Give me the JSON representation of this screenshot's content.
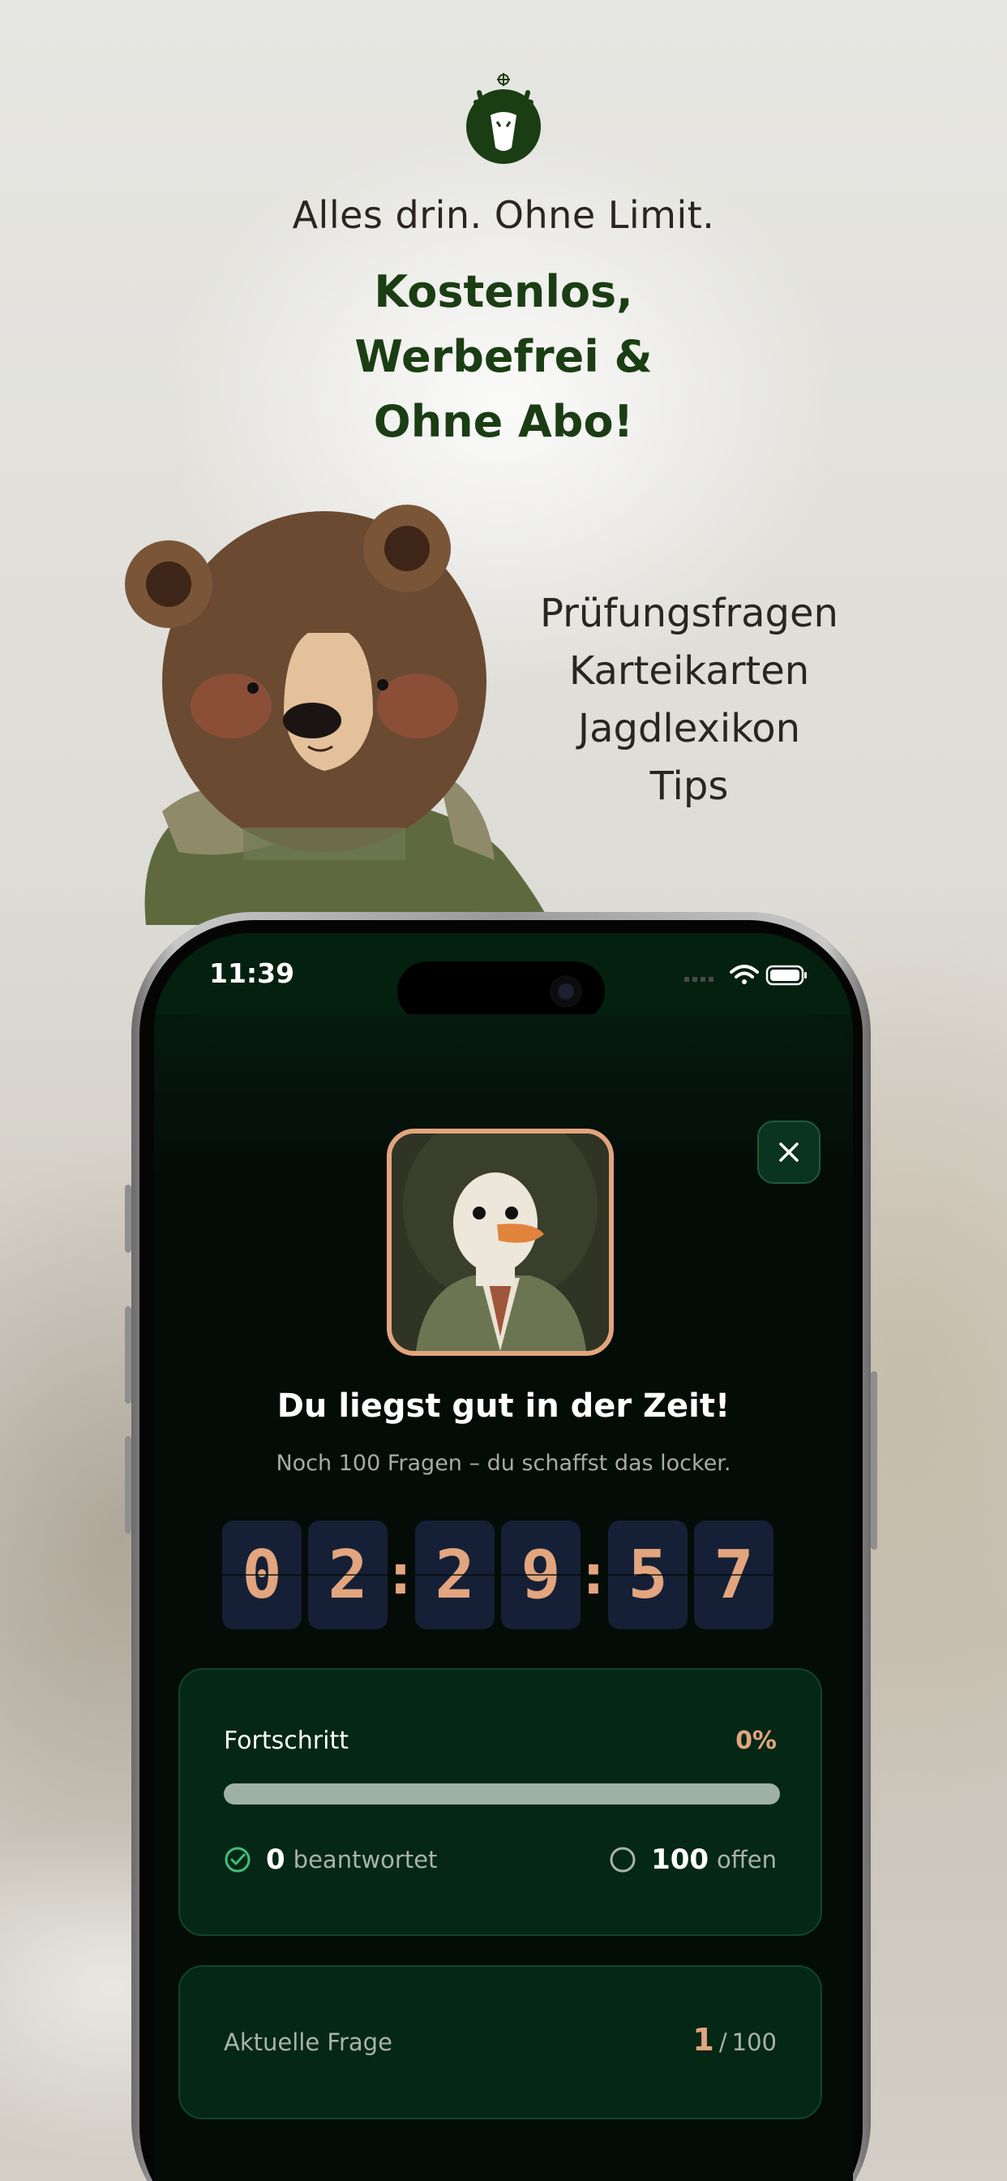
{
  "marketing": {
    "headline": "Alles drin. Ohne Limit.",
    "promo_lines": [
      "Kostenlos,",
      "Werbefrei &",
      "Ohne Abo!"
    ],
    "features": [
      "Prüfungsfragen",
      "Karteikarten",
      "Jagdlexikon",
      "Tips"
    ],
    "accent_color": "#1b3d13",
    "logo_icon": "deer-head-logo-icon",
    "illustration": "bear-in-jacket"
  },
  "statusbar": {
    "time": "11:39",
    "icons": [
      "signal-icon",
      "wifi-icon",
      "battery-icon"
    ]
  },
  "modal": {
    "avatar": "goose-portrait",
    "title": "Du liegst gut in der Zeit!",
    "subtitle": "Noch 100 Fragen – du schaffst das locker.",
    "timer": {
      "digits": [
        "0",
        "2",
        "2",
        "9",
        "5",
        "7"
      ],
      "separator": ":"
    },
    "progress": {
      "label": "Fortschritt",
      "percent_text": "0%",
      "fraction": 0,
      "answered_count": "0",
      "answered_label": "beantwortet",
      "open_count": "100",
      "open_label": "offen"
    },
    "current_question": {
      "label": "Aktuelle Frage",
      "current": "1",
      "separator": "/",
      "total": "100"
    },
    "colors": {
      "accent": "#e2a57e",
      "card_bg": "#052716",
      "digit_bg": "#152036",
      "success": "#3fbf7a"
    }
  }
}
